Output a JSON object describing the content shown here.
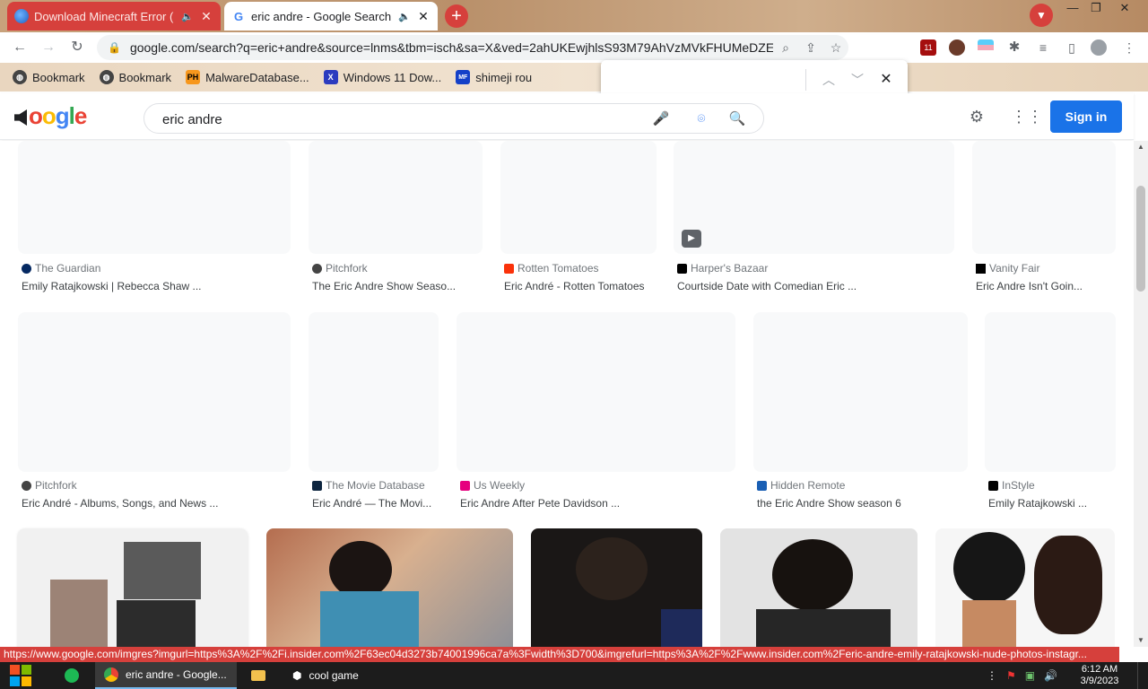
{
  "browser": {
    "tabs": [
      {
        "title": "Download Minecraft Error (",
        "active": false
      },
      {
        "title": "eric andre - Google Search",
        "active": true
      }
    ],
    "url": "google.com/search?q=eric+andre&source=lnms&tbm=isch&sa=X&ved=2ahUKEwjhlsS93M79AhVzMVkFHUMeDZEQ_...",
    "extension_badge": "11"
  },
  "bookmarks": [
    {
      "label": "Bookmark",
      "icon": "globe"
    },
    {
      "label": "Bookmark",
      "icon": "globe"
    },
    {
      "label": "MalwareDatabase...",
      "icon": "PH"
    },
    {
      "label": "Windows 11 Dow...",
      "icon": "X"
    },
    {
      "label": "shimeji rou",
      "icon": "MF"
    }
  ],
  "findbar": {
    "value": ""
  },
  "google": {
    "query": "eric andre",
    "signin_label": "Sign in"
  },
  "results": {
    "row1": [
      {
        "source": "The Guardian",
        "caption": "Emily Ratajkowski | Rebecca Shaw ...",
        "fav_color": "#052962"
      },
      {
        "source": "Pitchfork",
        "caption": "The Eric Andre Show Seaso...",
        "fav_color": "#444444"
      },
      {
        "source": "Rotten Tomatoes",
        "caption": "Eric André - Rotten Tomatoes",
        "fav_color": "#fa320a"
      },
      {
        "source": "Harper's Bazaar",
        "caption": "Courtside Date with Comedian Eric ...",
        "fav_color": "#000000"
      },
      {
        "source": "Vanity Fair",
        "caption": "Eric Andre Isn't Goin...",
        "fav_color": "#000000"
      }
    ],
    "row2": [
      {
        "source": "Pitchfork",
        "caption": "Eric André - Albums, Songs, and News ...",
        "fav_color": "#444444"
      },
      {
        "source": "The Movie Database",
        "caption": "Eric André — The Movi...",
        "fav_color": "#0d253f"
      },
      {
        "source": "Us Weekly",
        "caption": "Eric Andre After Pete Davidson ...",
        "fav_color": "#e6007e"
      },
      {
        "source": "Hidden Remote",
        "caption": "the Eric Andre Show season 6",
        "fav_color": "#1a5fb4"
      },
      {
        "source": "InStyle",
        "caption": "Emily Ratajkowski ...",
        "fav_color": "#000000"
      }
    ]
  },
  "statusbar": {
    "link": "https://www.google.com/imgres?imgurl=https%3A%2F%2Fi.insider.com%2F63ec04d3273b74001996ca7a%3Fwidth%3D700&imgrefurl=https%3A%2F%2Fwww.insider.com%2Feric-andre-emily-ratajkowski-nude-photos-instagr..."
  },
  "taskbar": {
    "items": [
      {
        "label": "eric andre - Google..."
      },
      {
        "label": "cool game"
      }
    ],
    "time": "6:12 AM",
    "date": "3/9/2023"
  },
  "colors": {
    "accent": "#1a73e8",
    "tab_red": "#d6403c"
  }
}
